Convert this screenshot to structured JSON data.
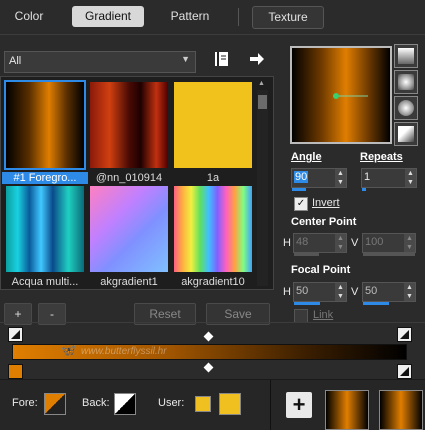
{
  "tabs": [
    "Color",
    "Gradient",
    "Pattern",
    "Texture"
  ],
  "filter": {
    "selected": "All"
  },
  "gallery": [
    {
      "label": "#1 Foregro...",
      "selected": true
    },
    {
      "label": "@nn_010914",
      "selected": false
    },
    {
      "label": "1a",
      "selected": false
    },
    {
      "label": "Acqua multi...",
      "selected": false
    },
    {
      "label": "akgradient1",
      "selected": false
    },
    {
      "label": "akgradient10",
      "selected": false
    }
  ],
  "buttons": {
    "add": "+",
    "remove": "-",
    "reset": "Reset",
    "save": "Save"
  },
  "angle": {
    "label": "Angle",
    "value": "90"
  },
  "repeats": {
    "label": "Repeats",
    "value": "1"
  },
  "invert": {
    "label": "Invert",
    "checked": true
  },
  "center_point": {
    "label": "Center Point",
    "h_label": "H",
    "h": "48",
    "v_label": "V",
    "v": "100"
  },
  "focal_point": {
    "label": "Focal Point",
    "h_label": "H",
    "h": "50",
    "v_label": "V",
    "v": "50"
  },
  "link": {
    "label": "Link"
  },
  "watermark": "www.butterflyssil.hr",
  "bottom": {
    "fore_label": "Fore:",
    "back_label": "Back:",
    "user_label": "User:",
    "add": "+"
  },
  "colors": {
    "accent": "#2d8ae6",
    "orange": "#e07e00",
    "yellow": "#f0c020"
  }
}
